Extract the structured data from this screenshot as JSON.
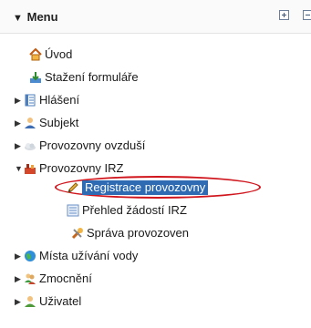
{
  "menu": {
    "title": "Menu",
    "expand_all": "expand-all",
    "collapse_all": "collapse-all"
  },
  "tree": {
    "uvod": "Úvod",
    "stazeni": "Stažení formuláře",
    "hlaseni": "Hlášení",
    "subjekt": "Subjekt",
    "provozovny_ovzdusi": "Provozovny ovzduší",
    "provozovny_irz": "Provozovny IRZ",
    "registrace": "Registrace provozovny",
    "prehled": "Přehled žádostí IRZ",
    "sprava": "Správa provozoven",
    "mista": "Místa užívání vody",
    "zmocneni": "Zmocnění",
    "uzivatel": "Uživatel"
  },
  "colors": {
    "selection": "#2f6bb3",
    "highlight_ring": "#d0151d"
  }
}
